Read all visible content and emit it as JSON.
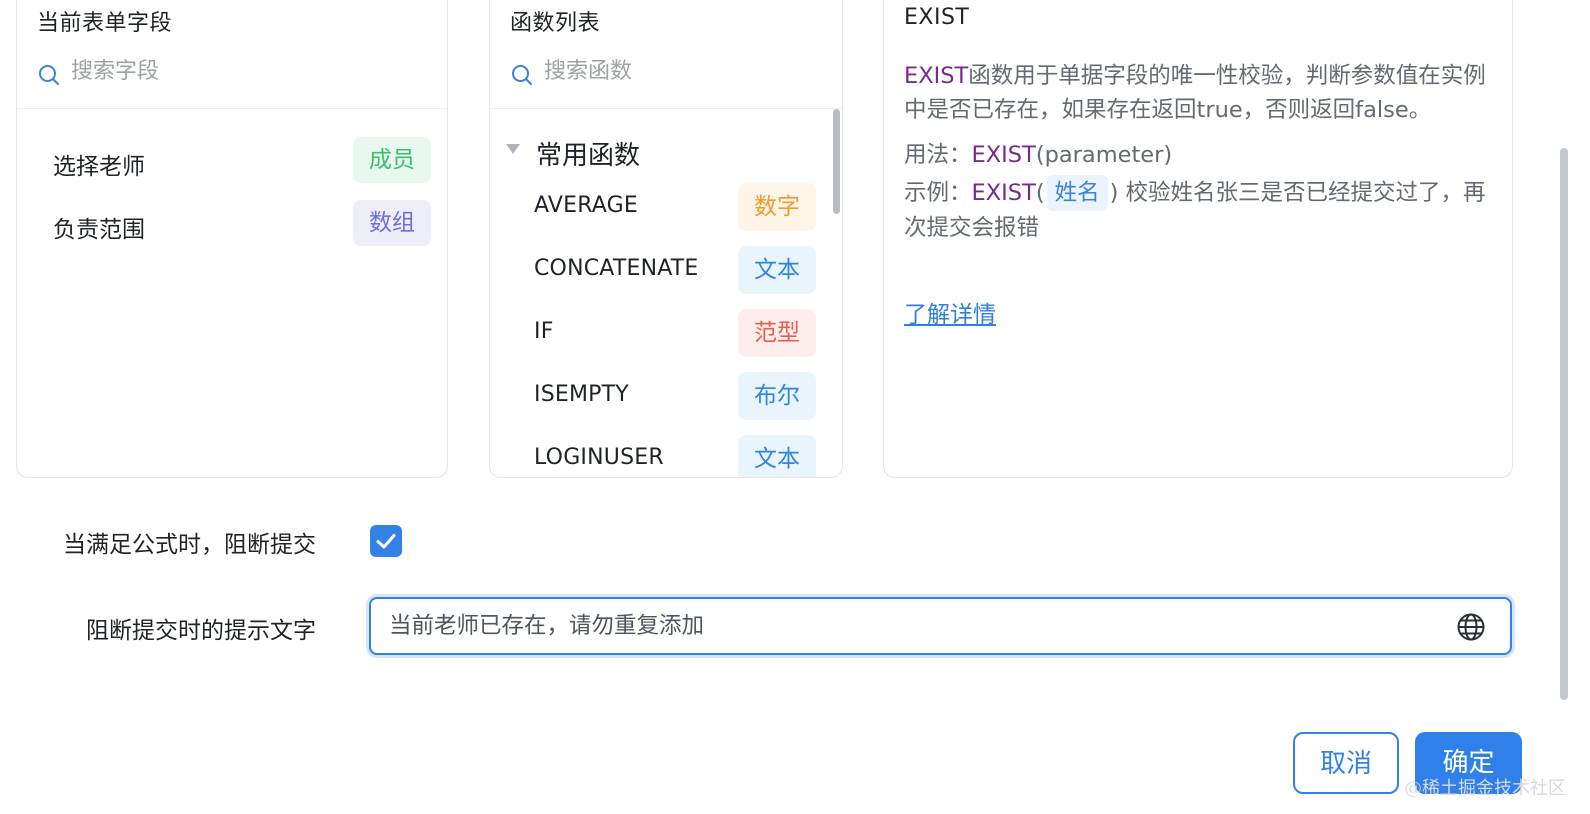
{
  "fields_panel": {
    "title": "当前表单字段",
    "search_placeholder": "搜索字段",
    "items": [
      {
        "label": "选择老师",
        "tag": "成员",
        "tag_color": "#3ebd6c",
        "tag_bg": "#e9f8ee"
      },
      {
        "label": "负责范围",
        "tag": "数组",
        "tag_color": "#6c6fde",
        "tag_bg": "#eeeefb"
      }
    ]
  },
  "functions_panel": {
    "title": "函数列表",
    "search_placeholder": "搜索函数",
    "group_label": "常用函数",
    "items": [
      {
        "name": "AVERAGE",
        "tag": "数字",
        "tag_color": "#f09b2c",
        "tag_bg": "#fef5e8"
      },
      {
        "name": "CONCATENATE",
        "tag": "文本",
        "tag_color": "#2f86e0",
        "tag_bg": "#eaf4fd"
      },
      {
        "name": "IF",
        "tag": "范型",
        "tag_color": "#ea5c4d",
        "tag_bg": "#fdeeec"
      },
      {
        "name": "ISEMPTY",
        "tag": "布尔",
        "tag_color": "#2f86e0",
        "tag_bg": "#eaf4fd"
      },
      {
        "name": "LOGINUSER",
        "tag": "文本",
        "tag_color": "#2f86e0",
        "tag_bg": "#eaf4fd"
      }
    ]
  },
  "detail_panel": {
    "title": "EXIST",
    "desc_keyword": "EXIST",
    "desc_text": "函数用于单据字段的唯一性校验，判断参数值在实例中是否已存在，如果存在返回true，否则返回false。",
    "usage_label": "用法：",
    "usage_keyword": "EXIST",
    "usage_args": "(parameter)",
    "example_label": "示例：",
    "example_keyword": "EXIST",
    "example_open": "(",
    "example_chip": "姓名",
    "example_close": ")",
    "example_text": "校验姓名张三是否已经提交过了，再次提交会报错",
    "learn_more": "了解详情"
  },
  "form": {
    "block_label": "当满足公式时，阻断提交",
    "block_checked": true,
    "prompt_label": "阻断提交时的提示文字",
    "prompt_value": "当前老师已存在，请勿重复添加"
  },
  "footer": {
    "cancel_label": "取消",
    "ok_label": "确定"
  },
  "watermark": "@稀土掘金技术社区",
  "colors": {
    "primary": "#3481e6",
    "keyword": "#7a2a8c",
    "link": "#2f7fdc"
  }
}
